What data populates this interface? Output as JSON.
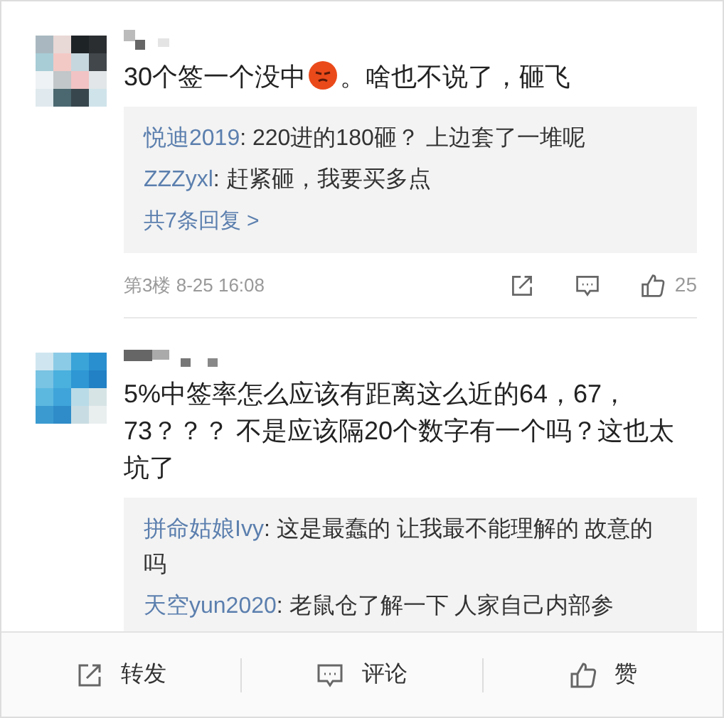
{
  "comments": [
    {
      "parts": [
        {
          "kind": "text",
          "text": "30个签一个没中"
        },
        {
          "kind": "emoji"
        },
        {
          "kind": "text",
          "text": "。啥也不说了，砸飞"
        }
      ],
      "avatar": {
        "kind": "picture"
      },
      "replies": [
        {
          "user": "悦迪2019",
          "text": ": 220进的180砸？ 上边套了一堆呢"
        },
        {
          "user": "ZZZyxl",
          "text": ": 赶紧砸，我要买多点"
        }
      ],
      "more": "共7条回复 >",
      "floor": "第3楼 8-25 16:08",
      "likes": "25"
    },
    {
      "parts": [
        {
          "kind": "text",
          "text": "5%中签率怎么应该有距离这么近的64，67，73？？？ 不是应该隔20个数字有一个吗？这也太坑了"
        }
      ],
      "avatar": {
        "kind": "picture"
      },
      "replies": [
        {
          "user": "拼命姑娘Ivy",
          "text": ": 这是最蠢的 让我最不能理解的 故意的吗"
        },
        {
          "user": "天空yun2020",
          "text": ": 老鼠仓了解一下 人家自己内部参"
        }
      ]
    }
  ],
  "actions": [
    {
      "kind": "repost",
      "label": "转发"
    },
    {
      "kind": "comment",
      "label": "评论"
    },
    {
      "kind": "like",
      "label": "赞"
    }
  ]
}
